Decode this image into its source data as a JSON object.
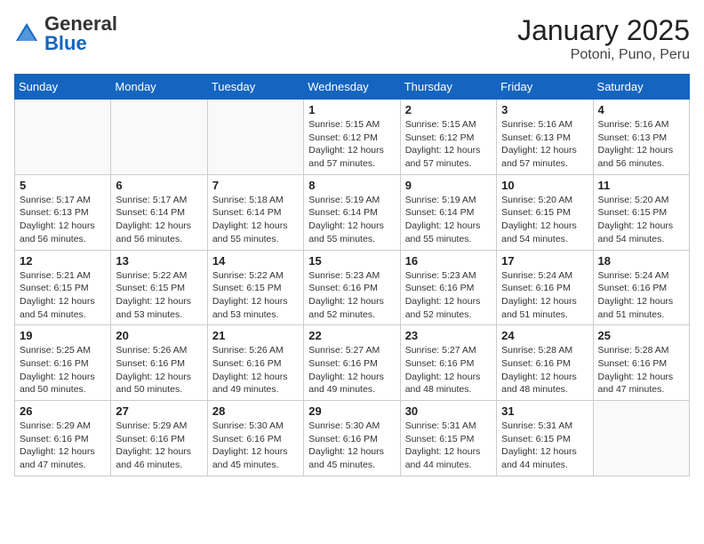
{
  "logo": {
    "general": "General",
    "blue": "Blue"
  },
  "header": {
    "month": "January 2025",
    "location": "Potoni, Puno, Peru"
  },
  "weekdays": [
    "Sunday",
    "Monday",
    "Tuesday",
    "Wednesday",
    "Thursday",
    "Friday",
    "Saturday"
  ],
  "weeks": [
    [
      {
        "day": "",
        "info": ""
      },
      {
        "day": "",
        "info": ""
      },
      {
        "day": "",
        "info": ""
      },
      {
        "day": "1",
        "info": "Sunrise: 5:15 AM\nSunset: 6:12 PM\nDaylight: 12 hours\nand 57 minutes."
      },
      {
        "day": "2",
        "info": "Sunrise: 5:15 AM\nSunset: 6:12 PM\nDaylight: 12 hours\nand 57 minutes."
      },
      {
        "day": "3",
        "info": "Sunrise: 5:16 AM\nSunset: 6:13 PM\nDaylight: 12 hours\nand 57 minutes."
      },
      {
        "day": "4",
        "info": "Sunrise: 5:16 AM\nSunset: 6:13 PM\nDaylight: 12 hours\nand 56 minutes."
      }
    ],
    [
      {
        "day": "5",
        "info": "Sunrise: 5:17 AM\nSunset: 6:13 PM\nDaylight: 12 hours\nand 56 minutes."
      },
      {
        "day": "6",
        "info": "Sunrise: 5:17 AM\nSunset: 6:14 PM\nDaylight: 12 hours\nand 56 minutes."
      },
      {
        "day": "7",
        "info": "Sunrise: 5:18 AM\nSunset: 6:14 PM\nDaylight: 12 hours\nand 55 minutes."
      },
      {
        "day": "8",
        "info": "Sunrise: 5:19 AM\nSunset: 6:14 PM\nDaylight: 12 hours\nand 55 minutes."
      },
      {
        "day": "9",
        "info": "Sunrise: 5:19 AM\nSunset: 6:14 PM\nDaylight: 12 hours\nand 55 minutes."
      },
      {
        "day": "10",
        "info": "Sunrise: 5:20 AM\nSunset: 6:15 PM\nDaylight: 12 hours\nand 54 minutes."
      },
      {
        "day": "11",
        "info": "Sunrise: 5:20 AM\nSunset: 6:15 PM\nDaylight: 12 hours\nand 54 minutes."
      }
    ],
    [
      {
        "day": "12",
        "info": "Sunrise: 5:21 AM\nSunset: 6:15 PM\nDaylight: 12 hours\nand 54 minutes."
      },
      {
        "day": "13",
        "info": "Sunrise: 5:22 AM\nSunset: 6:15 PM\nDaylight: 12 hours\nand 53 minutes."
      },
      {
        "day": "14",
        "info": "Sunrise: 5:22 AM\nSunset: 6:15 PM\nDaylight: 12 hours\nand 53 minutes."
      },
      {
        "day": "15",
        "info": "Sunrise: 5:23 AM\nSunset: 6:16 PM\nDaylight: 12 hours\nand 52 minutes."
      },
      {
        "day": "16",
        "info": "Sunrise: 5:23 AM\nSunset: 6:16 PM\nDaylight: 12 hours\nand 52 minutes."
      },
      {
        "day": "17",
        "info": "Sunrise: 5:24 AM\nSunset: 6:16 PM\nDaylight: 12 hours\nand 51 minutes."
      },
      {
        "day": "18",
        "info": "Sunrise: 5:24 AM\nSunset: 6:16 PM\nDaylight: 12 hours\nand 51 minutes."
      }
    ],
    [
      {
        "day": "19",
        "info": "Sunrise: 5:25 AM\nSunset: 6:16 PM\nDaylight: 12 hours\nand 50 minutes."
      },
      {
        "day": "20",
        "info": "Sunrise: 5:26 AM\nSunset: 6:16 PM\nDaylight: 12 hours\nand 50 minutes."
      },
      {
        "day": "21",
        "info": "Sunrise: 5:26 AM\nSunset: 6:16 PM\nDaylight: 12 hours\nand 49 minutes."
      },
      {
        "day": "22",
        "info": "Sunrise: 5:27 AM\nSunset: 6:16 PM\nDaylight: 12 hours\nand 49 minutes."
      },
      {
        "day": "23",
        "info": "Sunrise: 5:27 AM\nSunset: 6:16 PM\nDaylight: 12 hours\nand 48 minutes."
      },
      {
        "day": "24",
        "info": "Sunrise: 5:28 AM\nSunset: 6:16 PM\nDaylight: 12 hours\nand 48 minutes."
      },
      {
        "day": "25",
        "info": "Sunrise: 5:28 AM\nSunset: 6:16 PM\nDaylight: 12 hours\nand 47 minutes."
      }
    ],
    [
      {
        "day": "26",
        "info": "Sunrise: 5:29 AM\nSunset: 6:16 PM\nDaylight: 12 hours\nand 47 minutes."
      },
      {
        "day": "27",
        "info": "Sunrise: 5:29 AM\nSunset: 6:16 PM\nDaylight: 12 hours\nand 46 minutes."
      },
      {
        "day": "28",
        "info": "Sunrise: 5:30 AM\nSunset: 6:16 PM\nDaylight: 12 hours\nand 45 minutes."
      },
      {
        "day": "29",
        "info": "Sunrise: 5:30 AM\nSunset: 6:16 PM\nDaylight: 12 hours\nand 45 minutes."
      },
      {
        "day": "30",
        "info": "Sunrise: 5:31 AM\nSunset: 6:15 PM\nDaylight: 12 hours\nand 44 minutes."
      },
      {
        "day": "31",
        "info": "Sunrise: 5:31 AM\nSunset: 6:15 PM\nDaylight: 12 hours\nand 44 minutes."
      },
      {
        "day": "",
        "info": ""
      }
    ]
  ]
}
